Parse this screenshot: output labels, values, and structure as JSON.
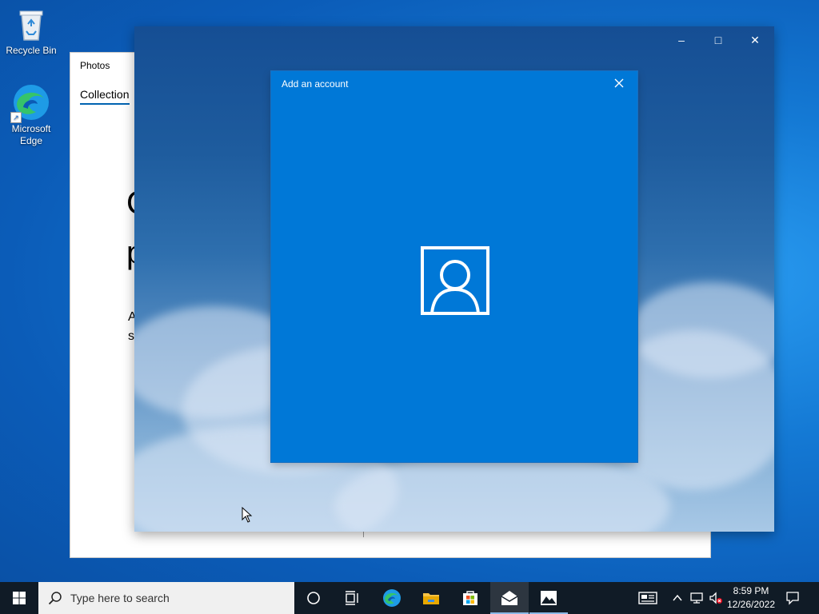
{
  "desktop": {
    "icons": [
      {
        "label": "Recycle Bin",
        "icon": "recycle-bin-icon"
      },
      {
        "label": "Microsoft Edge",
        "icon": "edge-icon"
      }
    ]
  },
  "photos_window": {
    "title": "Photos",
    "tab": "Collection",
    "heading_line1": "C",
    "heading_line2": "p",
    "body_line1": "A",
    "body_line2": "s"
  },
  "mail_window": {
    "controls": {
      "minimize": "–",
      "maximize": "□",
      "close": "✕"
    }
  },
  "dialog": {
    "title": "Add an account",
    "icon": "person-icon"
  },
  "taskbar": {
    "search_placeholder": "Type here to search",
    "apps": [
      "cortana-icon",
      "task-view-icon",
      "edge-icon",
      "file-explorer-icon",
      "store-icon",
      "mail-icon",
      "photos-icon"
    ],
    "tray": {
      "time": "8:59 PM",
      "date": "12/26/2022"
    }
  },
  "colors": {
    "accent": "#0078d7",
    "taskbar": "#101b26"
  }
}
